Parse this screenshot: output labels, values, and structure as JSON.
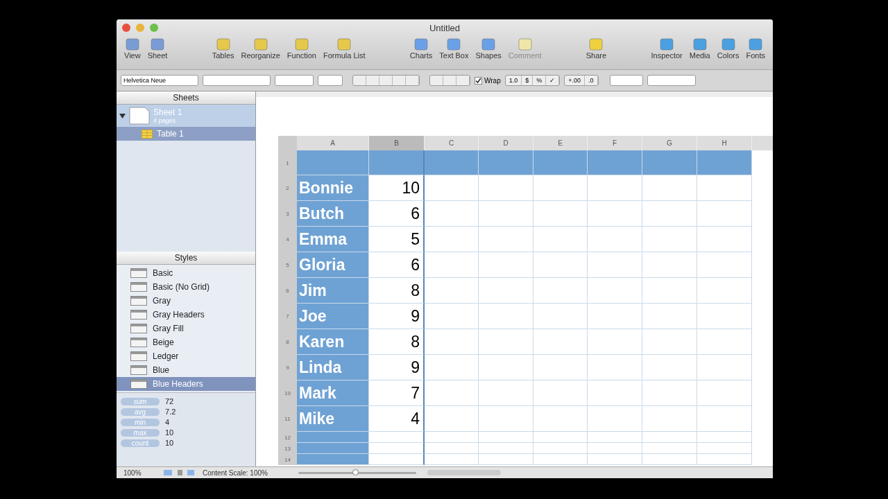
{
  "window": {
    "title": "Untitled"
  },
  "toolbar": [
    [
      {
        "label": "View",
        "disabled": false
      },
      {
        "label": "Sheet",
        "disabled": false
      }
    ],
    [
      {
        "label": "Tables",
        "disabled": false
      },
      {
        "label": "Reorganize",
        "disabled": false
      },
      {
        "label": "Function",
        "disabled": false
      },
      {
        "label": "Formula List",
        "disabled": false
      }
    ],
    [
      {
        "label": "Charts",
        "disabled": false
      },
      {
        "label": "Text Box",
        "disabled": false
      },
      {
        "label": "Shapes",
        "disabled": false
      },
      {
        "label": "Comment",
        "disabled": true
      }
    ],
    [
      {
        "label": "Share",
        "disabled": false
      }
    ],
    [
      {
        "label": "Inspector",
        "disabled": false
      },
      {
        "label": "Media",
        "disabled": false
      },
      {
        "label": "Colors",
        "disabled": false
      },
      {
        "label": "Fonts",
        "disabled": false
      }
    ]
  ],
  "format_bar": {
    "font": "Helvetica Neue",
    "wrap": {
      "label": "Wrap",
      "checked": true
    },
    "number_buttons": [
      "1.0",
      "$",
      "%",
      "✓"
    ],
    "decimal_buttons": [
      "+.00",
      ".0"
    ]
  },
  "sheets": {
    "title": "Sheets",
    "items": [
      {
        "name": "Sheet 1",
        "subtitle": "4 pages",
        "expanded": true,
        "children": [
          {
            "name": "Table 1",
            "selected": true
          }
        ]
      }
    ]
  },
  "styles": {
    "title": "Styles",
    "items": [
      {
        "name": "Basic",
        "selected": false
      },
      {
        "name": "Basic (No Grid)",
        "selected": false
      },
      {
        "name": "Gray",
        "selected": false
      },
      {
        "name": "Gray Headers",
        "selected": false
      },
      {
        "name": "Gray Fill",
        "selected": false
      },
      {
        "name": "Beige",
        "selected": false
      },
      {
        "name": "Ledger",
        "selected": false
      },
      {
        "name": "Blue",
        "selected": false
      },
      {
        "name": "Blue Headers",
        "selected": true
      }
    ]
  },
  "stats": [
    {
      "label": "sum",
      "value": "72"
    },
    {
      "label": "avg",
      "value": "7.2"
    },
    {
      "label": "min",
      "value": "4"
    },
    {
      "label": "max",
      "value": "10"
    },
    {
      "label": "count",
      "value": "10"
    }
  ],
  "table": {
    "columns": [
      {
        "label": "A",
        "selected": false
      },
      {
        "label": "B",
        "selected": true
      },
      {
        "label": "C",
        "selected": false
      },
      {
        "label": "D",
        "selected": false
      },
      {
        "label": "E",
        "selected": false
      },
      {
        "label": "F",
        "selected": false
      },
      {
        "label": "G",
        "selected": false
      },
      {
        "label": "H",
        "selected": false
      }
    ],
    "rows": [
      {
        "number": "1",
        "cells": []
      },
      {
        "number": "2",
        "cells": [
          "Bonnie",
          "10"
        ]
      },
      {
        "number": "3",
        "cells": [
          "Butch",
          "6"
        ]
      },
      {
        "number": "4",
        "cells": [
          "Emma",
          "5"
        ]
      },
      {
        "number": "5",
        "cells": [
          "Gloria",
          "6"
        ]
      },
      {
        "number": "6",
        "cells": [
          "Jim",
          "8"
        ]
      },
      {
        "number": "7",
        "cells": [
          "Joe",
          "9"
        ]
      },
      {
        "number": "8",
        "cells": [
          "Karen",
          "8"
        ]
      },
      {
        "number": "9",
        "cells": [
          "Linda",
          "9"
        ]
      },
      {
        "number": "10",
        "cells": [
          "Mark",
          "7"
        ]
      },
      {
        "number": "11",
        "cells": [
          "Mike",
          "4"
        ]
      },
      {
        "number": "12",
        "cells": []
      },
      {
        "number": "13",
        "cells": []
      },
      {
        "number": "14",
        "cells": []
      }
    ]
  },
  "status_bar": {
    "zoom": "100%",
    "content_scale": "Content Scale: 100%",
    "scale_slider": {
      "level": 0.49
    }
  }
}
